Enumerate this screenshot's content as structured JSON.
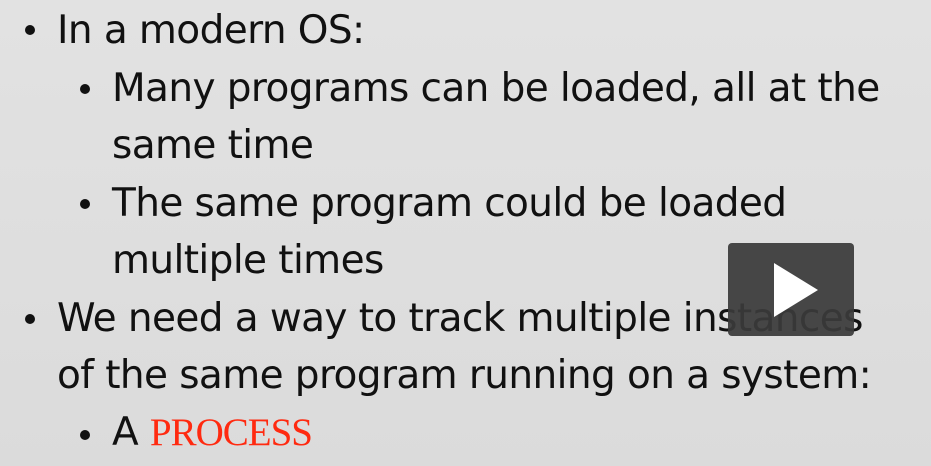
{
  "slide": {
    "bullets": [
      {
        "text": "In a modern OS:",
        "level": 1
      },
      {
        "text_lines": [
          "Many programs can be loaded, all at the",
          "same time"
        ],
        "level": 2
      },
      {
        "text_lines": [
          "The same program could be loaded",
          "multiple times"
        ],
        "level": 2
      },
      {
        "text_lines": [
          "We need a way to track multiple instances",
          "of the same program running on a system:"
        ],
        "level": 1
      },
      {
        "prefix": "A ",
        "emphasis": "PROCESS",
        "level": 2
      }
    ],
    "accent_color": "#ff2a10"
  },
  "video_overlay": {
    "icon": "play-icon"
  }
}
